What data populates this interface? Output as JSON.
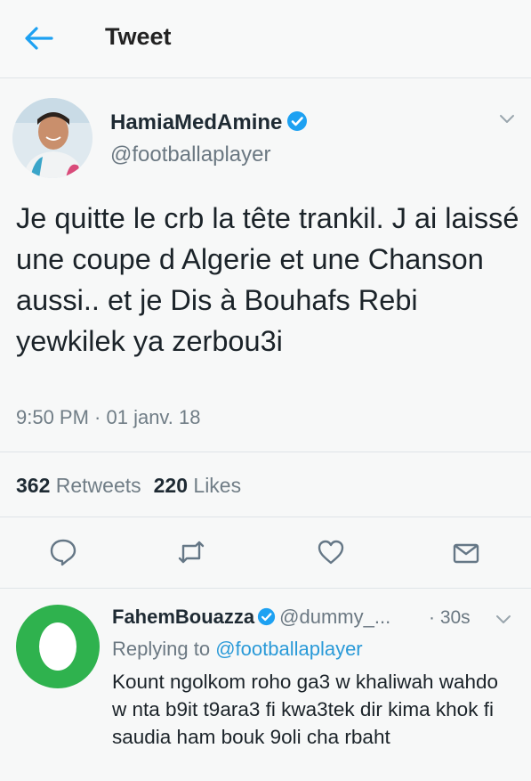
{
  "header": {
    "title": "Tweet",
    "back_icon": "arrow-left-icon"
  },
  "tweet": {
    "author_name": "HamiaMedAmine",
    "author_handle": "@footballaplayer",
    "verified": true,
    "text": "Je quitte le crb la tête trankil. J ai laissé une coupe d Algerie et une Chanson aussi.. et je Dis à Bouhafs Rebi yewkilek ya zerbou3i",
    "timestamp": "9:50 PM · 01 janv. 18",
    "retweets_count": "362",
    "retweets_label": "Retweets",
    "likes_count": "220",
    "likes_label": "Likes",
    "actions": [
      "reply-icon",
      "retweet-icon",
      "like-icon",
      "share-icon"
    ]
  },
  "reply": {
    "author_name": "FahemBouazza",
    "author_handle": "@dummy_...",
    "verified": true,
    "time": "· 30s",
    "replying_prefix": "Replying to",
    "replying_to": "@footballaplayer",
    "text": "Kount ngolkom roho ga3 w khaliwah wahdo w nta b9it t9ara3 fi kwa3tek dir kima khok fi saudia ham bouk 9oli cha rbaht"
  },
  "colors": {
    "accent": "#1da1f2",
    "reply_avatar_green": "#2fb24e",
    "muted_text": "#707d86"
  }
}
